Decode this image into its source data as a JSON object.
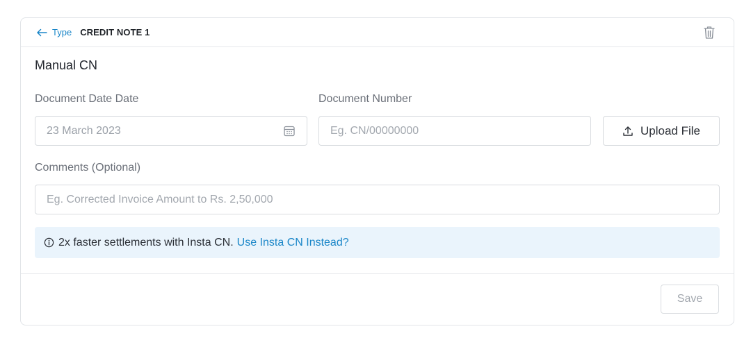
{
  "header": {
    "back_label": "Type",
    "title": "CREDIT NOTE 1"
  },
  "form": {
    "section_title": "Manual CN",
    "document_date": {
      "label": "Document Date Date",
      "value": "23 March 2023"
    },
    "document_number": {
      "label": "Document Number",
      "placeholder": "Eg. CN/00000000"
    },
    "upload_label": "Upload File",
    "comments": {
      "label": "Comments (Optional)",
      "placeholder": "Eg. Corrected Invoice Amount to Rs. 2,50,000"
    }
  },
  "info_banner": {
    "text": "2x faster settlements with Insta CN.",
    "link_text": "Use Insta CN Instead?"
  },
  "footer": {
    "save_label": "Save"
  },
  "icons": {
    "back": "arrow-left-icon",
    "delete": "trash-icon",
    "calendar": "calendar-icon",
    "upload": "upload-icon",
    "info": "info-icon"
  },
  "colors": {
    "accent": "#1a86c8",
    "info_bg": "#eaf4fc",
    "border": "#d8dbdf"
  }
}
